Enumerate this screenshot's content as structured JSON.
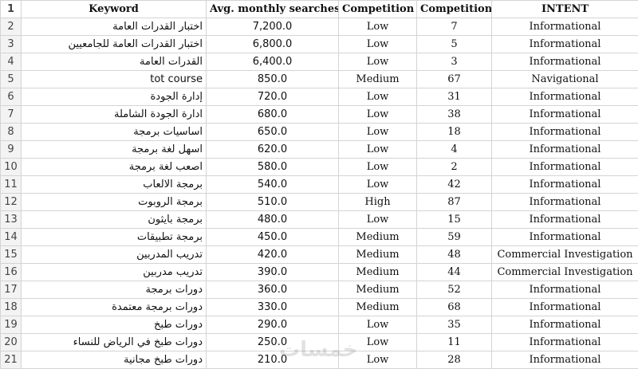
{
  "header": {
    "corner": "1",
    "columns": [
      "Keyword",
      "Avg. monthly searches",
      "Competition",
      "Competition",
      "INTENT"
    ]
  },
  "rows": [
    {
      "num": "2",
      "keyword": "اختبار القدرات العامة",
      "searches": "7,200.0",
      "competition": "Low",
      "score": "7",
      "intent": "Informational"
    },
    {
      "num": "3",
      "keyword": "اختبار القدرات العامة للجامعيين",
      "searches": "6,800.0",
      "competition": "Low",
      "score": "5",
      "intent": "Informational"
    },
    {
      "num": "4",
      "keyword": "القدرات العامة",
      "searches": "6,400.0",
      "competition": "Low",
      "score": "3",
      "intent": "Informational"
    },
    {
      "num": "5",
      "keyword": "tot course",
      "searches": "850.0",
      "competition": "Medium",
      "score": "67",
      "intent": "Navigational"
    },
    {
      "num": "6",
      "keyword": "إدارة الجودة",
      "searches": "720.0",
      "competition": "Low",
      "score": "31",
      "intent": "Informational"
    },
    {
      "num": "7",
      "keyword": "ادارة الجودة الشاملة",
      "searches": "680.0",
      "competition": "Low",
      "score": "38",
      "intent": "Informational"
    },
    {
      "num": "8",
      "keyword": "اساسيات برمجة",
      "searches": "650.0",
      "competition": "Low",
      "score": "18",
      "intent": "Informational"
    },
    {
      "num": "9",
      "keyword": "اسهل لغة برمجة",
      "searches": "620.0",
      "competition": "Low",
      "score": "4",
      "intent": "Informational"
    },
    {
      "num": "10",
      "keyword": "اصعب لغة برمجة",
      "searches": "580.0",
      "competition": "Low",
      "score": "2",
      "intent": "Informational"
    },
    {
      "num": "11",
      "keyword": "برمجة الالعاب",
      "searches": "540.0",
      "competition": "Low",
      "score": "42",
      "intent": "Informational"
    },
    {
      "num": "12",
      "keyword": "برمجة الروبوت",
      "searches": "510.0",
      "competition": "High",
      "score": "87",
      "intent": "Informational"
    },
    {
      "num": "13",
      "keyword": "برمجة بايثون",
      "searches": "480.0",
      "competition": "Low",
      "score": "15",
      "intent": "Informational"
    },
    {
      "num": "14",
      "keyword": "برمجة تطبيقات",
      "searches": "450.0",
      "competition": "Medium",
      "score": "59",
      "intent": "Informational"
    },
    {
      "num": "15",
      "keyword": "تدريب المدربين",
      "searches": "420.0",
      "competition": "Medium",
      "score": "48",
      "intent": "Commercial Investigation"
    },
    {
      "num": "16",
      "keyword": "تدريب مدربين",
      "searches": "390.0",
      "competition": "Medium",
      "score": "44",
      "intent": "Commercial Investigation"
    },
    {
      "num": "17",
      "keyword": "دورات برمجة",
      "searches": "360.0",
      "competition": "Medium",
      "score": "52",
      "intent": "Informational"
    },
    {
      "num": "18",
      "keyword": "دورات برمجة معتمدة",
      "searches": "330.0",
      "competition": "Medium",
      "score": "68",
      "intent": "Informational"
    },
    {
      "num": "19",
      "keyword": "دورات طبخ",
      "searches": "290.0",
      "competition": "Low",
      "score": "35",
      "intent": "Informational"
    },
    {
      "num": "20",
      "keyword": "دورات طبخ في الرياض للنساء",
      "searches": "250.0",
      "competition": "Low",
      "score": "11",
      "intent": "Informational"
    },
    {
      "num": "21",
      "keyword": "دورات طبخ مجانية",
      "searches": "210.0",
      "competition": "Low",
      "score": "28",
      "intent": "Informational"
    }
  ],
  "watermark": "خمسات",
  "colors": {
    "gridline": "#d4d4d4",
    "row_header_bg": "#f3f3f3",
    "selected_accent": "#1e7145"
  }
}
